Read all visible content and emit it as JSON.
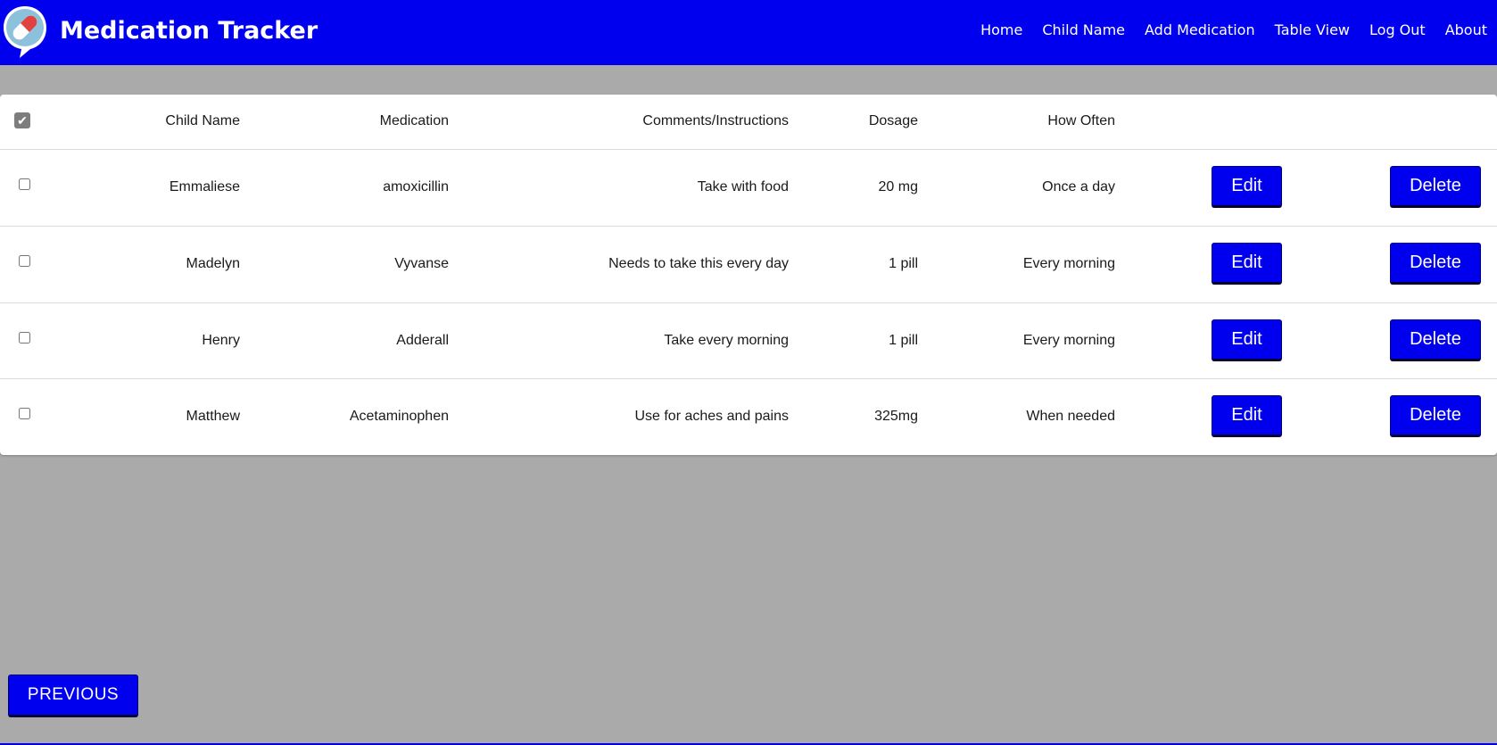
{
  "navbar": {
    "title": "Medication Tracker",
    "logo_icon": "pill-chat-bubble-icon",
    "links": [
      "Home",
      "Child Name",
      "Add Medication",
      "Table View",
      "Log Out",
      "About"
    ]
  },
  "table": {
    "headers": {
      "child_name": "Child Name",
      "medication": "Medication",
      "comments": "Comments/Instructions",
      "dosage": "Dosage",
      "how_often": "How Often"
    },
    "select_all_checked": true,
    "rows": [
      {
        "child_name": "Emmaliese",
        "medication": "amoxicillin",
        "comments": "Take with food",
        "dosage": "20 mg",
        "how_often": "Once a day",
        "checked": false
      },
      {
        "child_name": "Madelyn",
        "medication": "Vyvanse",
        "comments": "Needs to take this every day",
        "dosage": "1 pill",
        "how_often": "Every morning",
        "checked": false
      },
      {
        "child_name": "Henry",
        "medication": "Adderall",
        "comments": "Take every morning",
        "dosage": "1 pill",
        "how_often": "Every morning",
        "checked": false
      },
      {
        "child_name": "Matthew",
        "medication": "Acetaminophen",
        "comments": "Use for aches and pains",
        "dosage": "325mg",
        "how_often": "When needed",
        "checked": false
      }
    ],
    "edit_label": "Edit",
    "delete_label": "Delete"
  },
  "pagination": {
    "previous_label": "PREVIOUS"
  },
  "colors": {
    "primary": "#0000ee",
    "background": "#aaaaaa",
    "card": "#ffffff"
  }
}
